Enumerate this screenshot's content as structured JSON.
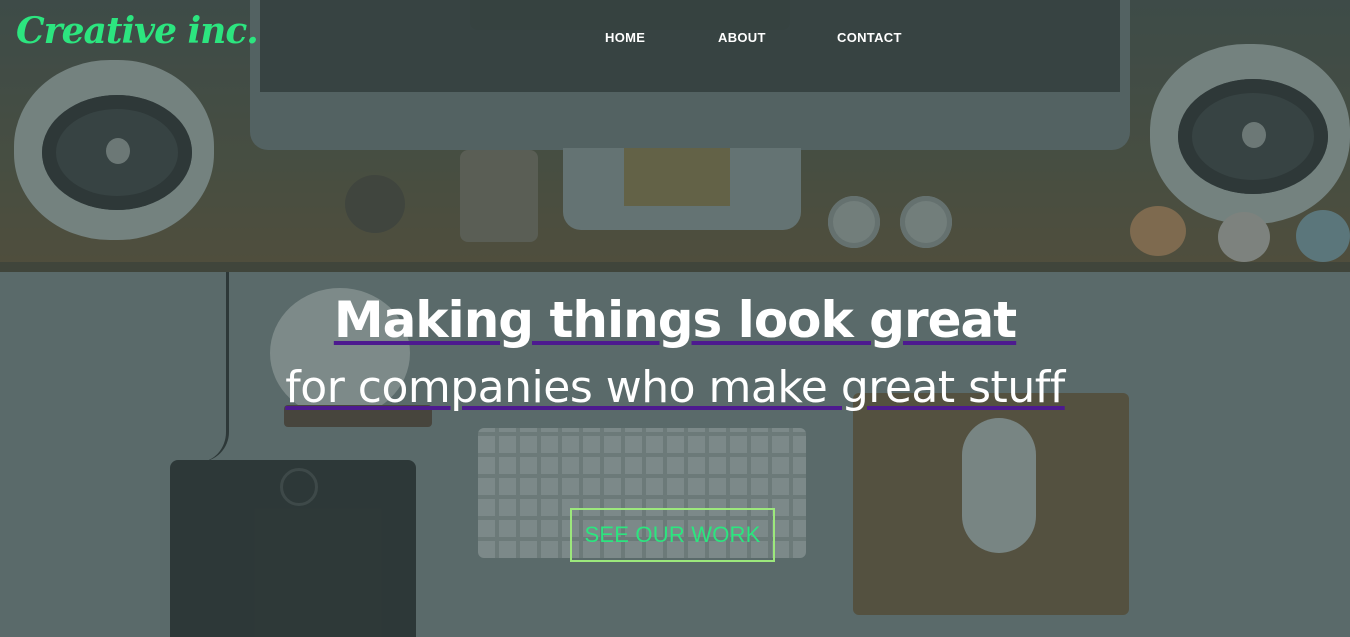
{
  "brand": {
    "logo_text": "Creative inc."
  },
  "nav": {
    "items": [
      {
        "label": "HOME"
      },
      {
        "label": "ABOUT"
      },
      {
        "label": "CONTACT"
      }
    ]
  },
  "hero": {
    "headline": "Making things look great",
    "subline": "for companies who make great stuff",
    "cta_label": "SEE OUR WORK"
  },
  "colors": {
    "logo": "#2ce57f",
    "cta_text": "#2ce57f",
    "cta_border": "#9ce87c",
    "underline": "#4d1a8f",
    "text": "#ffffff"
  }
}
